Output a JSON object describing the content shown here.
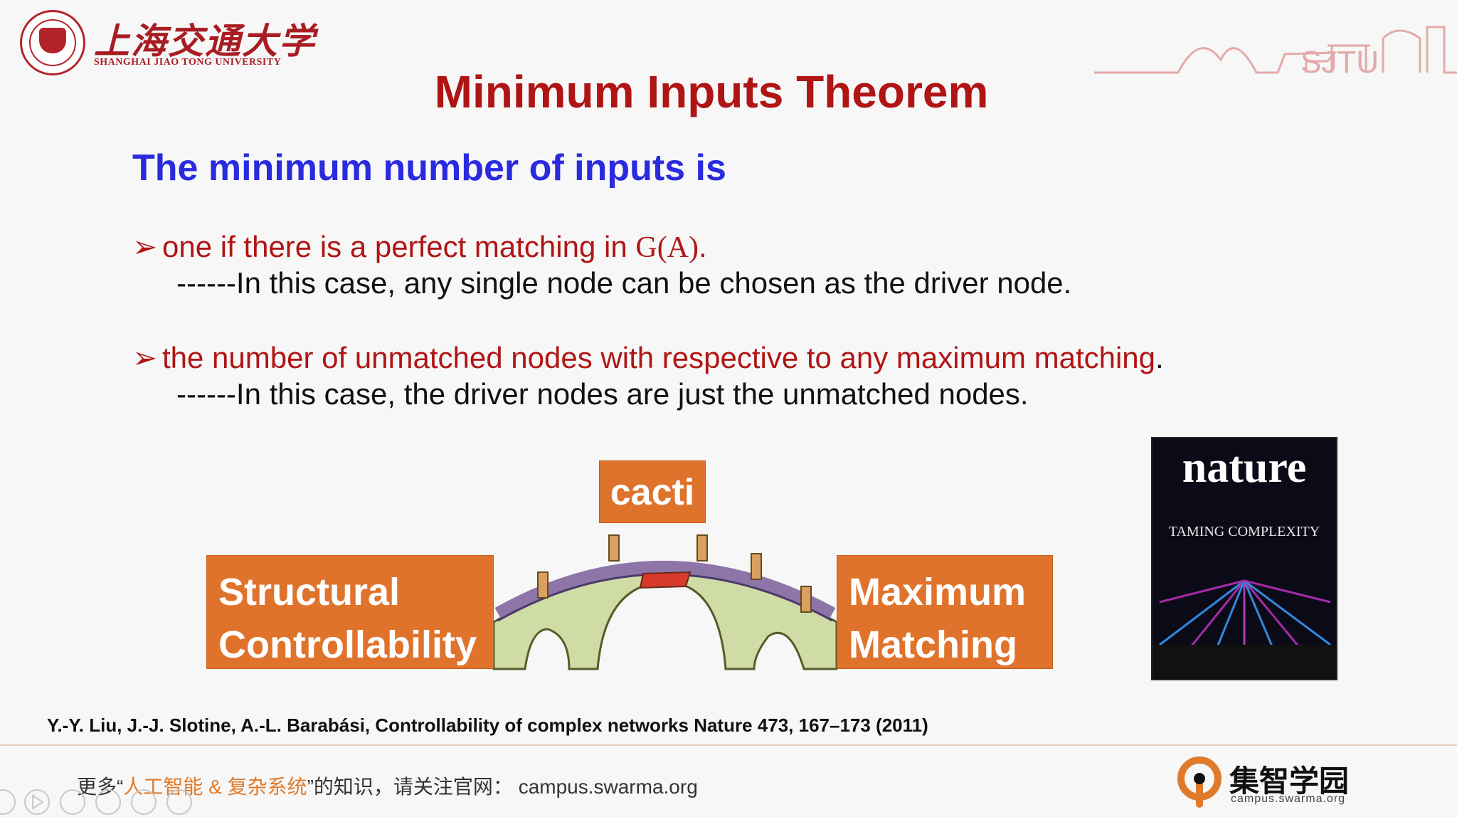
{
  "header": {
    "university_cn": "上海交通大学",
    "university_en": "SHANGHAI JIAO TONG UNIVERSITY",
    "sjtu_mark": "SJTU"
  },
  "slide": {
    "title": "Minimum Inputs Theorem",
    "subtitle": "The minimum number of inputs is",
    "bullets": [
      {
        "marker": "➢",
        "text": "one if there is a perfect matching in ",
        "math": "G(A)",
        "end": ".",
        "detail": "------In this case, any single node can be chosen as the driver node."
      },
      {
        "marker": "➢",
        "text": "the number of unmatched nodes with respective to any maximum matching",
        "math": "",
        "end": ".",
        "detail": "------In this case, the driver nodes are just the unmatched nodes."
      }
    ],
    "diagram": {
      "left_line1": "Structural",
      "left_line2": "Controllability",
      "right_line1": "Maximum",
      "right_line2": "Matching",
      "top": "cacti"
    },
    "cover": {
      "title": "nature",
      "caption": "TAMING COMPLEXITY"
    },
    "reference": "Y.-Y. Liu, J.-J. Slotine, A.-L. Barabási, Controllability of complex networks Nature 473, 167–173 (2011)"
  },
  "footer": {
    "prefix": "更多“",
    "highlight": "人工智能 & 复杂系统",
    "suffix": "”的知识，请关注官网：",
    "url": "campus.swarma.org",
    "brand_cn": "集智学园",
    "brand_en": "campus.swarma.org"
  },
  "colors": {
    "title": "#b01515",
    "subtitle": "#2a2adf",
    "box": "#e0732c",
    "footer_highlight": "#e07a2a"
  }
}
